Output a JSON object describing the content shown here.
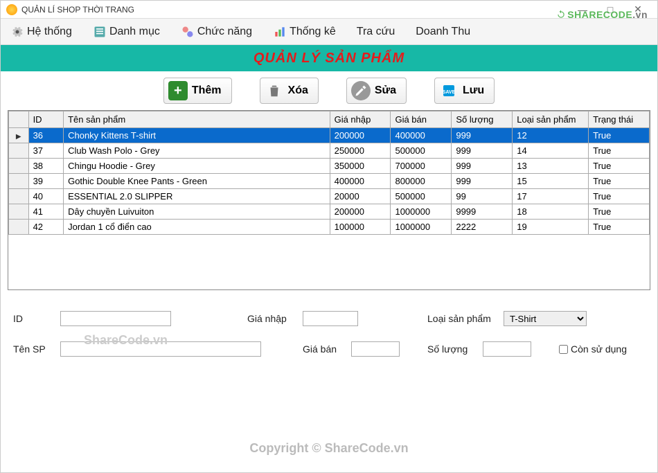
{
  "window": {
    "title": "QUẢN LÍ SHOP THỜI TRANG",
    "min": "—",
    "max": "□",
    "close": "✕",
    "watermark_brand": "SHARECODE",
    "watermark_suffix": ".vn"
  },
  "menu": {
    "hethong": "Hệ thống",
    "danhmuc": "Danh mục",
    "chucnang": "Chức năng",
    "thongke": "Thống kê",
    "tracuu": "Tra cứu",
    "doanhthu": "Doanh Thu"
  },
  "banner": "QUẢN LÝ SẢN PHẨM",
  "toolbar": {
    "add": "Thêm",
    "del": "Xóa",
    "edit": "Sửa",
    "save": "Lưu"
  },
  "grid": {
    "headers": {
      "id": "ID",
      "ten": "Tên sản phẩm",
      "gianhap": "Giá nhập",
      "giaban": "Giá bán",
      "soluong": "Số lượng",
      "loai": "Loại sản phẩm",
      "trangthai": "Trạng thái"
    },
    "rows": [
      {
        "id": "36",
        "ten": "Chonky Kittens T-shirt",
        "gianhap": "200000",
        "giaban": "400000",
        "soluong": "999",
        "loai": "12",
        "trangthai": "True",
        "selected": true
      },
      {
        "id": "37",
        "ten": "Club Wash Polo - Grey",
        "gianhap": "250000",
        "giaban": "500000",
        "soluong": "999",
        "loai": "14",
        "trangthai": "True"
      },
      {
        "id": "38",
        "ten": "Chingu Hoodie - Grey",
        "gianhap": "350000",
        "giaban": "700000",
        "soluong": "999",
        "loai": "13",
        "trangthai": "True"
      },
      {
        "id": "39",
        "ten": "Gothic Double Knee Pants - Green",
        "gianhap": "400000",
        "giaban": "800000",
        "soluong": "999",
        "loai": "15",
        "trangthai": "True"
      },
      {
        "id": "40",
        "ten": " ESSENTIAL 2.0 SLIPPER",
        "gianhap": "20000",
        "giaban": "500000",
        "soluong": "99",
        "loai": "17",
        "trangthai": "True"
      },
      {
        "id": "41",
        "ten": "Dây chuyền Luivuiton",
        "gianhap": "200000",
        "giaban": "1000000",
        "soluong": "9999",
        "loai": "18",
        "trangthai": "True"
      },
      {
        "id": "42",
        "ten": "Jordan 1 cổ điển cao",
        "gianhap": "100000",
        "giaban": "1000000",
        "soluong": "2222",
        "loai": "19",
        "trangthai": "True"
      }
    ]
  },
  "form": {
    "id_label": "ID",
    "id_value": "",
    "gianhap_label": "Giá nhập",
    "gianhap_value": "",
    "loai_label": "Loại sản phẩm",
    "loai_value": "T-Shirt",
    "ten_label": "Tên SP",
    "ten_value": "",
    "giaban_label": "Giá bán",
    "giaban_value": "",
    "soluong_label": "Số lượng",
    "soluong_value": "",
    "checkbox_label": "Còn sử dụng"
  },
  "watermarks": {
    "center": "ShareCode.vn",
    "bottom": "Copyright © ShareCode.vn"
  }
}
